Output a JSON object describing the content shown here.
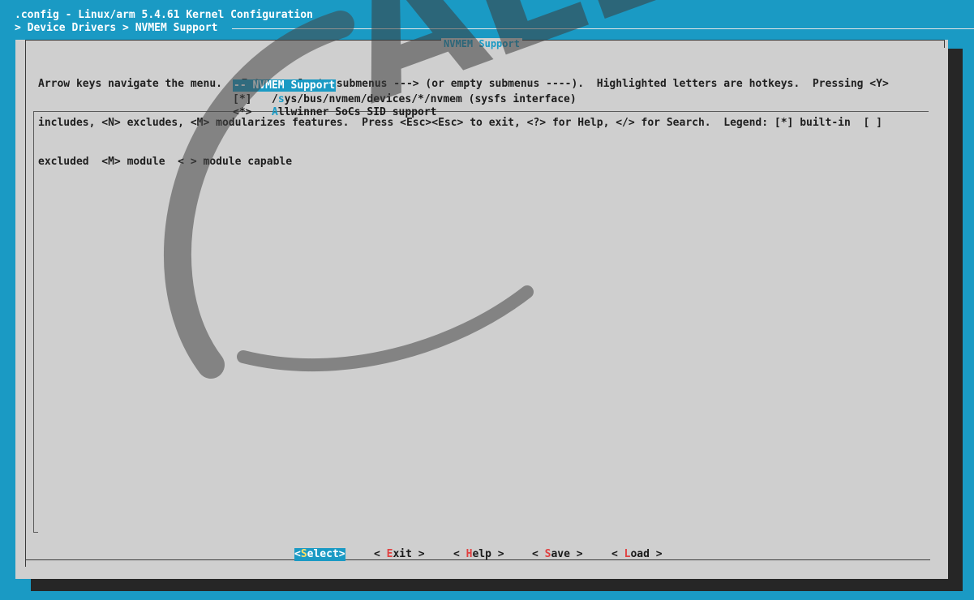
{
  "window": {
    "title": ".config - Linux/arm 5.4.61 Kernel Configuration",
    "breadcrumb": "> Device Drivers > NVMEM Support"
  },
  "dialog": {
    "title": "NVMEM Support",
    "help_lines": [
      "Arrow keys navigate the menu.  <Enter> selects submenus ---> (or empty submenus ----).  Highlighted letters are hotkeys.  Pressing <Y>",
      "includes, <N> excludes, <M> modularizes features.  Press <Esc><Esc> to exit, <?> for Help, </> for Search.  Legend: [*] built-in  [ ]",
      "excluded  <M> module  < > module capable"
    ]
  },
  "menu": {
    "items": [
      {
        "mark": "-",
        "mark_rest": "-",
        "label": " NVMEM Support",
        "selected": true
      },
      {
        "mark": "[*]",
        "hotkey": "/",
        "label_pre": "",
        "label_hotkey": "s",
        "label": "ys/bus/nvmem/devices/*/nvmem (sysfs interface)",
        "prefix": "/"
      },
      {
        "mark": "<*>",
        "label_hotkey": "A",
        "label": "llwinner SoCs SID support"
      }
    ]
  },
  "buttons": {
    "select": {
      "pre": "<",
      "hotkey": "S",
      "rest": "elect>"
    },
    "exit": {
      "pre": "< ",
      "hotkey": "E",
      "rest": "xit >"
    },
    "help": {
      "pre": "< ",
      "hotkey": "H",
      "rest": "elp >"
    },
    "save": {
      "pre": "< ",
      "hotkey": "S",
      "rest": "ave >"
    },
    "load": {
      "pre": "< ",
      "hotkey": "L",
      "rest": "oad >"
    }
  },
  "watermark": {
    "text": "ALLWINNER"
  },
  "colors": {
    "background": "#1a9ac4",
    "dialog": "#cfcfcf",
    "hotkey": "#e04040",
    "accent": "#1a9ac4"
  }
}
